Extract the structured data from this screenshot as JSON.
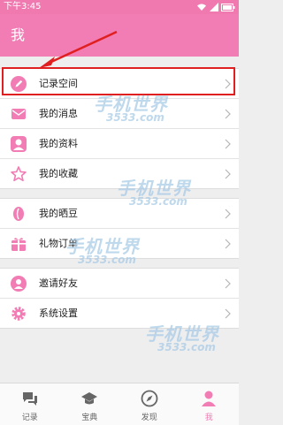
{
  "status_bar": {
    "time": "下午3:45"
  },
  "header": {
    "title": "我"
  },
  "menu": {
    "items": [
      {
        "label": "记录空间",
        "icon": "pencil-icon"
      },
      {
        "label": "我的消息",
        "icon": "envelope-icon"
      },
      {
        "label": "我的资料",
        "icon": "user-icon"
      },
      {
        "label": "我的收藏",
        "icon": "star-icon"
      },
      {
        "label": "我的晒豆",
        "icon": "bean-icon"
      },
      {
        "label": "礼物订单",
        "icon": "gift-icon"
      },
      {
        "label": "邀请好友",
        "icon": "invite-icon"
      },
      {
        "label": "系统设置",
        "icon": "gear-icon"
      }
    ]
  },
  "watermark": {
    "main": "手机世界",
    "sub": "3533.com"
  },
  "tab_bar": {
    "tabs": [
      {
        "label": "记录",
        "icon": "chat-icon"
      },
      {
        "label": "宝典",
        "icon": "graduation-cap-icon"
      },
      {
        "label": "发现",
        "icon": "compass-icon"
      },
      {
        "label": "我",
        "icon": "person-icon",
        "active": true
      }
    ]
  },
  "colors": {
    "header": "#f27cb4",
    "accent": "#f27cb4",
    "highlight": "#e02020"
  }
}
